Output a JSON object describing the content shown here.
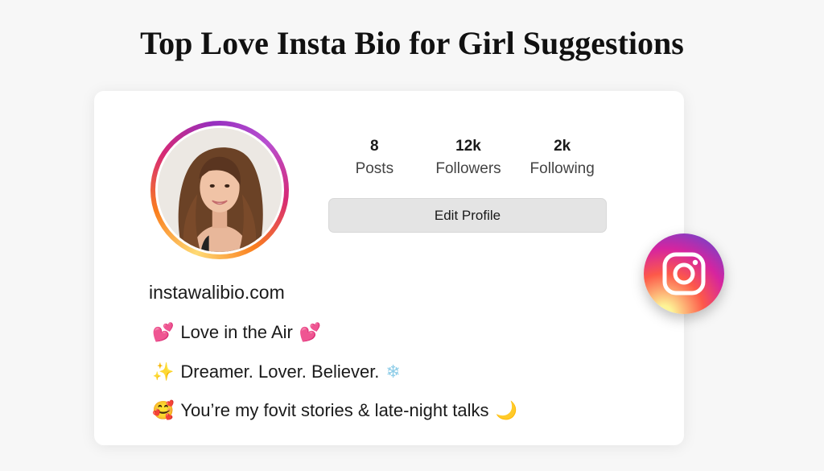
{
  "page": {
    "title": "Top Love Insta Bio for Girl Suggestions"
  },
  "profile": {
    "avatar_icon": "profile-photo",
    "stats": [
      {
        "count": "8",
        "label": "Posts"
      },
      {
        "count": "12k",
        "label": "Followers"
      },
      {
        "count": "2k",
        "label": "Following"
      }
    ],
    "edit_button_label": "Edit Profile",
    "website": "instawalibio.com",
    "bio": [
      {
        "lead": "💕",
        "text": "Love in the Air",
        "trail": "💕"
      },
      {
        "lead": "✨",
        "text": "Dreamer. Lover. Believer.",
        "trail": "❄"
      },
      {
        "lead": "🥰",
        "text": "You’re my fovit stories & late-night talks",
        "trail": "🌙"
      }
    ]
  },
  "badge": {
    "icon": "instagram-icon",
    "colors": [
      "#feda75",
      "#fd5949",
      "#d6249f",
      "#285AEB"
    ]
  },
  "colors": {
    "background": "#f7f7f7",
    "card": "#ffffff",
    "button": "#e4e4e4"
  }
}
